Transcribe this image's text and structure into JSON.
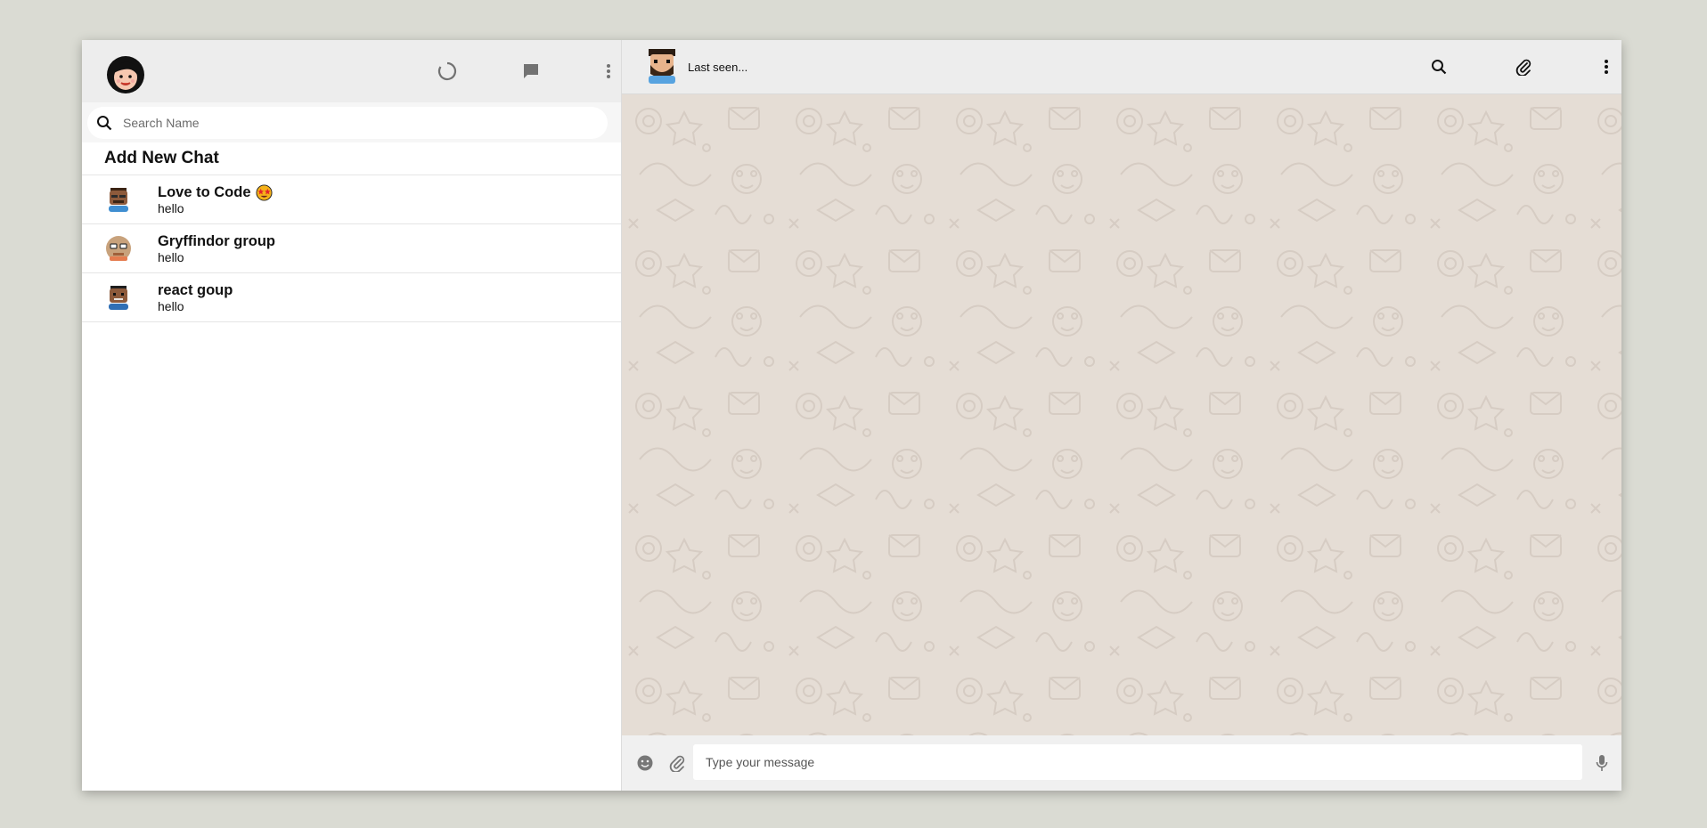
{
  "sidebar": {
    "header": {
      "profile_avatar": "user-avatar",
      "icons": [
        "status-icon",
        "new-chat-icon",
        "more-vertical-icon"
      ]
    },
    "search": {
      "placeholder": "Search Name"
    },
    "add_new_chat": "Add New Chat",
    "chats": [
      {
        "name": "Love to Code",
        "emoji": "star-struck-emoji",
        "last_message": "hello"
      },
      {
        "name": "Gryffindor group",
        "last_message": "hello"
      },
      {
        "name": "react goup",
        "last_message": "hello"
      }
    ]
  },
  "chat": {
    "header": {
      "status": "Last seen...",
      "icons": [
        "search-icon",
        "attach-icon",
        "more-vertical-icon"
      ]
    },
    "footer": {
      "placeholder": "Type your message",
      "icons": [
        "emoji-icon",
        "attach-icon",
        "mic-icon"
      ]
    }
  },
  "colors": {
    "page_bg": "#dadbd3",
    "header_bg": "#ededed",
    "chat_bg": "#e5ddd5",
    "footer_bg": "#f0f0f0"
  }
}
